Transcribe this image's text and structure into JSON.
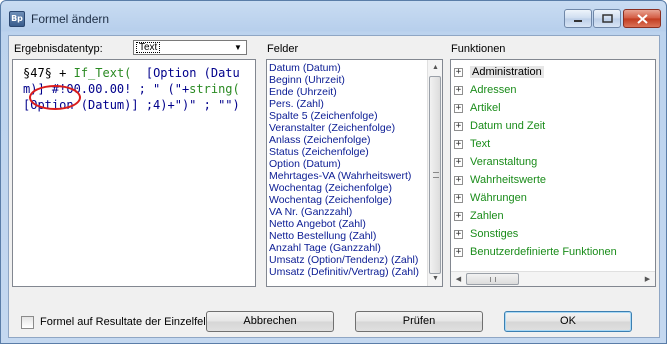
{
  "window": {
    "title": "Formel ändern",
    "app_icon_text": "Bp"
  },
  "result_type": {
    "label": "Ergebnisdatentyp:",
    "value": "Text"
  },
  "formula": {
    "token1": "§47§",
    "rest1": " + ",
    "fn1": "If_Text(",
    "rest2": "  [Option (Datum)] #!00.00.00! ; \" (\"+",
    "fn2": "string(",
    "rest3": " [Option (Datum)] ;4)+\")\" ; \"\")"
  },
  "felder": {
    "header": "Felder",
    "items": [
      "Datum (Datum)",
      "Beginn (Uhrzeit)",
      "Ende (Uhrzeit)",
      "Pers. (Zahl)",
      "Spalte 5 (Zeichenfolge)",
      "Veranstalter (Zeichenfolge)",
      "Anlass (Zeichenfolge)",
      "Status (Zeichenfolge)",
      "Option (Datum)",
      "Mehrtages-VA (Wahrheitswert)",
      "Wochentag (Zeichenfolge)",
      "Wochentag (Zeichenfolge)",
      "VA Nr. (Ganzzahl)",
      "Netto Angebot (Zahl)",
      "Netto Bestellung (Zahl)",
      "Anzahl Tage (Ganzzahl)",
      "Umsatz (Option/Tendenz) (Zahl)",
      "Umsatz (Definitiv/Vertrag) (Zahl)"
    ]
  },
  "funktionen": {
    "header": "Funktionen",
    "items": [
      "Administration",
      "Adressen",
      "Artikel",
      "Datum und Zeit",
      "Text",
      "Veranstaltung",
      "Wahrheitswerte",
      "Währungen",
      "Zahlen",
      "Sonstiges",
      "Benutzerdefinierte Funktionen"
    ],
    "expander": "+"
  },
  "checkbox": {
    "label": "Formel auf Resultate der Einzelfelde"
  },
  "buttons": {
    "cancel": "Abbrechen",
    "check": "Prüfen",
    "ok": "OK"
  }
}
